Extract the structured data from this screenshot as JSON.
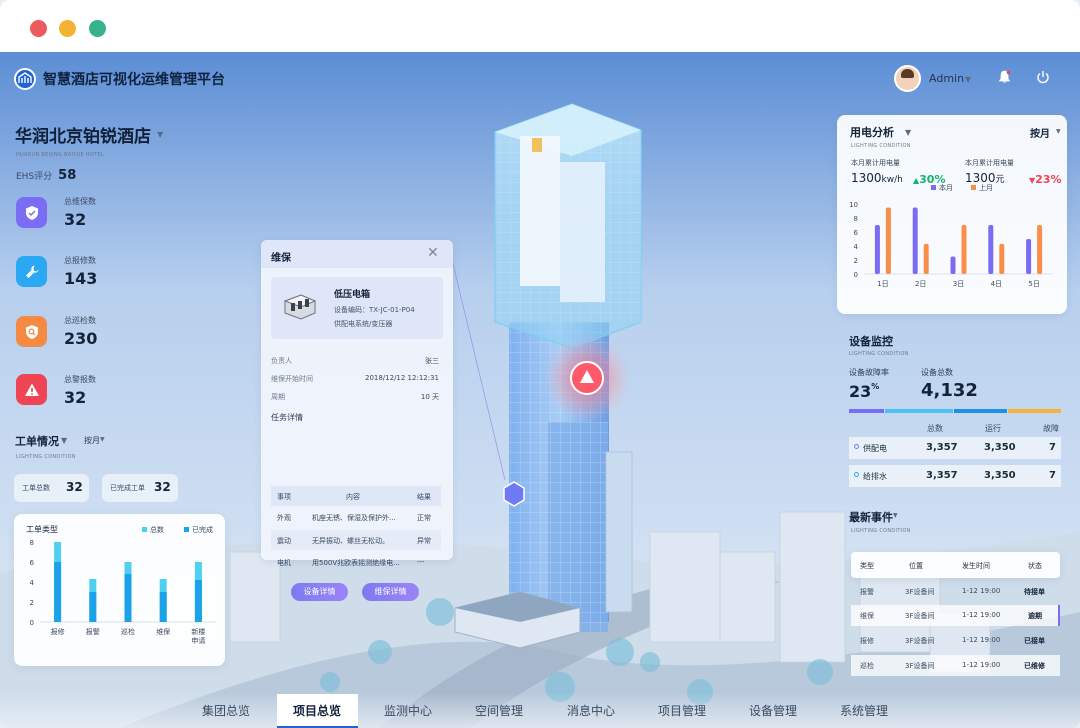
{
  "window": {
    "controls": [
      "close",
      "minimize",
      "zoom"
    ],
    "colors": {
      "close": "#ed5a5e",
      "minimize": "#f3b234",
      "zoom": "#36b38c"
    }
  },
  "header": {
    "title": "智慧酒店可视化运维管理平台",
    "user": "Admin",
    "icons": [
      "logo-icon",
      "bell-icon",
      "power-icon"
    ]
  },
  "hotel": {
    "name": "华润北京铂锐酒店",
    "name_en": "HUARUN BEIJING BAIYUE HOTEL",
    "ehs_label": "EHS评分",
    "ehs_value": "58"
  },
  "stats": [
    {
      "label": "总维保数",
      "value": "32",
      "icon": "shield-icon",
      "color": "#7b6cf4"
    },
    {
      "label": "总报修数",
      "value": "143",
      "icon": "wrench-icon",
      "color": "#2aa9f2"
    },
    {
      "label": "总巡检数",
      "value": "230",
      "icon": "search-shield-icon",
      "color": "#f48a43"
    },
    {
      "label": "总警报数",
      "value": "32",
      "icon": "warning-icon",
      "color": "#ef4453"
    }
  ],
  "workorder": {
    "title": "工单情况",
    "period": "按月",
    "sub": "LIGHTING CONDITION",
    "total_label": "工单总数",
    "total_value": "32",
    "done_label": "已完成工单",
    "done_value": "32"
  },
  "chart_data": [
    {
      "type": "bar",
      "title": "工单类型",
      "categories": [
        "报修",
        "报警",
        "巡检",
        "维保",
        "新楼申请"
      ],
      "series": [
        {
          "name": "总数",
          "values": [
            8,
            4.3,
            6,
            4.3,
            6
          ],
          "color": "#4fd0f2"
        },
        {
          "name": "已完成",
          "values": [
            6,
            3,
            4.8,
            3,
            4.2
          ],
          "color": "#1aa3e8"
        }
      ],
      "yticks": [
        0,
        2,
        4,
        6,
        8
      ],
      "ylim": [
        0,
        8
      ]
    },
    {
      "type": "bar",
      "title": "用电分析",
      "categories": [
        "1日",
        "2日",
        "3日",
        "4日",
        "5日"
      ],
      "series": [
        {
          "name": "本月",
          "values": [
            7,
            9.5,
            2.5,
            7,
            5
          ],
          "color": "#7b6cf4"
        },
        {
          "name": "上月",
          "values": [
            9.5,
            4.3,
            7,
            4.3,
            7
          ],
          "color": "#f98d4a"
        }
      ],
      "yticks": [
        0,
        2,
        4,
        6,
        8,
        10
      ],
      "ylim": [
        0,
        10
      ]
    }
  ],
  "power": {
    "title": "用电分析",
    "sub": "LIGHTING CONDITION",
    "period": "按月",
    "m1_label": "本月累计用电量",
    "m1_value": "1300",
    "m1_unit": "kw/h",
    "m1_change": "30%",
    "m2_label": "本月累计用电量",
    "m2_value": "1300",
    "m2_unit": "元",
    "m2_change": "23%"
  },
  "device": {
    "title": "设备监控",
    "sub": "LIGHTING CONDITION",
    "fault_label": "设备故障率",
    "fault_value": "23",
    "fault_unit": "%",
    "total_label": "设备总数",
    "total_value": "4,132",
    "headers": [
      "总数",
      "运行",
      "故障"
    ],
    "rows": [
      {
        "name": "供配电",
        "total": "3,357",
        "running": "3,350",
        "fault": "7",
        "color": "#6a83f5"
      },
      {
        "name": "给排水",
        "total": "3,357",
        "running": "3,350",
        "fault": "7",
        "color": "#2aa9f2"
      }
    ],
    "bar_colors": [
      "#7b6cf4",
      "#4fc1f3",
      "#1f8fe8",
      "#f7b13f"
    ]
  },
  "events": {
    "title": "最新事件",
    "sub": "LIGHTING CONDITION",
    "headers": [
      "类型",
      "位置",
      "发生时间",
      "状态"
    ],
    "rows": [
      {
        "type": "报警",
        "loc": "3F设备间",
        "time": "1-12 19:00",
        "status": "待接单"
      },
      {
        "type": "维保",
        "loc": "3F设备间",
        "time": "1-12 19:00",
        "status": "逾期"
      },
      {
        "type": "报修",
        "loc": "3F设备间",
        "time": "1-12 19:00",
        "status": "已接单"
      },
      {
        "type": "巡检",
        "loc": "3F设备间",
        "time": "1-12 19:00",
        "status": "已维修"
      }
    ]
  },
  "popup": {
    "title": "维保",
    "device_name": "低压电箱",
    "device_code": "设备编码：TX-JC-01-P04",
    "device_type": "供配电系统/变压器",
    "owner_label": "负责人",
    "owner_value": "张三",
    "start_label": "维保开始时间",
    "start_value": "2018/12/12 12:12:31",
    "cycle_label": "周期",
    "cycle_value": "10 天",
    "task_label": "任务详情",
    "headers": [
      "事项",
      "内容",
      "结果"
    ],
    "rows": [
      {
        "item": "外观",
        "content": "机座无锈、保湿及保护外...",
        "result": "正常"
      },
      {
        "item": "震动",
        "content": "无异振动、螺丝无松动。",
        "result": "异常"
      },
      {
        "item": "电机",
        "content": "用500V兆欧表摇测绝缘电...",
        "result": "---"
      }
    ],
    "btn_device": "设备详情",
    "btn_maint": "维保详情"
  },
  "nav": {
    "items": [
      "集团总览",
      "项目总览",
      "监测中心",
      "空间管理",
      "消息中心",
      "项目管理",
      "设备管理",
      "系统管理"
    ],
    "active": 1
  }
}
